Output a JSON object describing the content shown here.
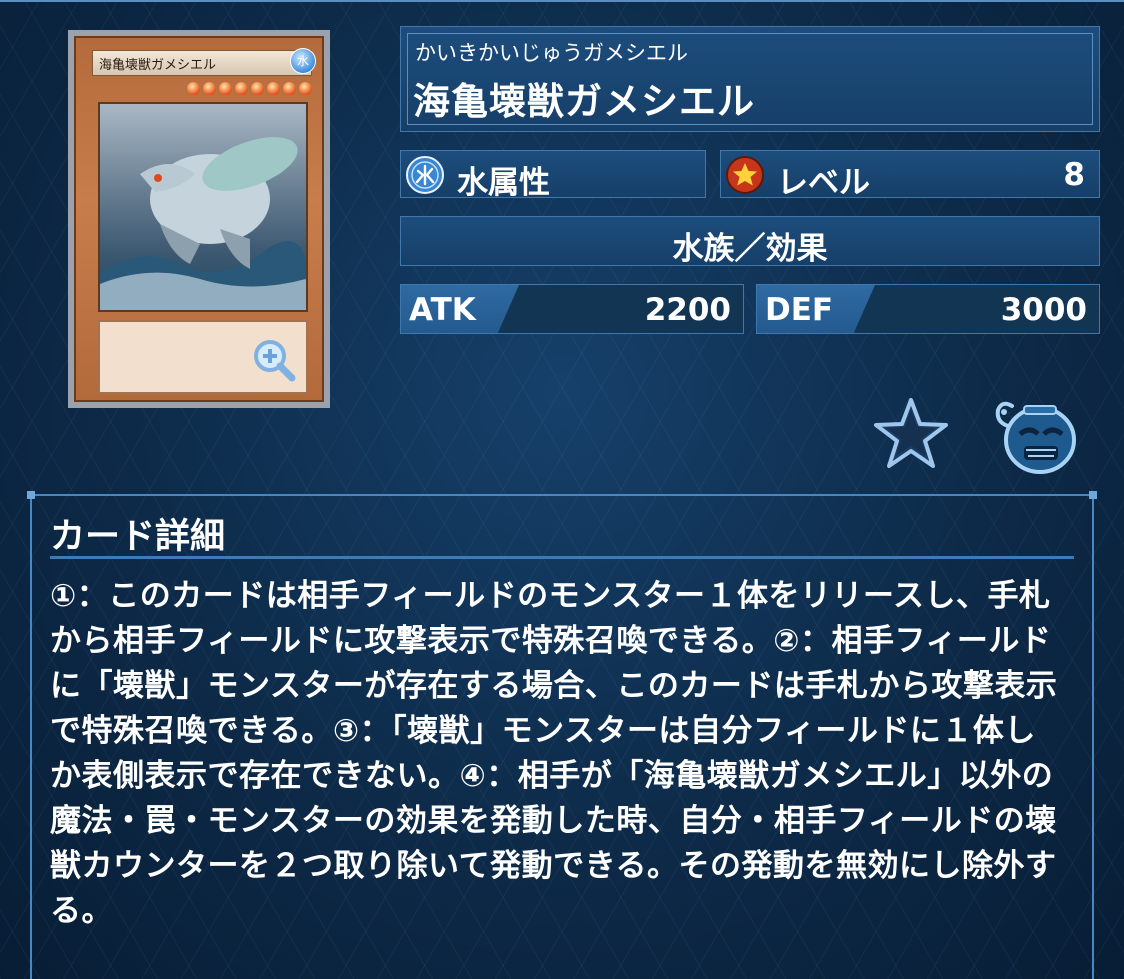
{
  "card": {
    "furigana": "かいきかいじゅうガメシエル",
    "name": "海亀壊獣ガメシエル",
    "attribute_label": "水属性",
    "attribute_icon": "water-attribute-icon",
    "level_label": "レベル",
    "level_value": "8",
    "type_label": "水族／効果",
    "atk_label": "ATK",
    "atk_value": "2200",
    "def_label": "DEF",
    "def_value": "3000",
    "image_name": "海亀壊獣ガメシエル",
    "image_attr_glyph": "水"
  },
  "detail": {
    "heading": "カード詳細",
    "text": "①：このカードは相手フィールドのモンスター１体をリリースし、手札から相手フィールドに攻撃表示で特殊召喚できる。②：相手フィールドに「壊獣」モンスターが存在する場合、このカードは手札から攻撃表示で特殊召喚できる。③：「壊獣」モンスターは自分フィールドに１体しか表側表示で存在できない。④：相手が「海亀壊獣ガメシエル」以外の魔法・罠・モンスターの効果を発動した時、自分・相手フィールドの壊獣カウンターを２つ取り除いて発動できる。その発動を無効にし除外する。"
  },
  "icons": {
    "zoom": "zoom-in-icon",
    "favorite": "star-icon",
    "deck": "deck-pot-icon",
    "level": "level-star-icon"
  },
  "colors": {
    "background": "#0d2a48",
    "panel": "#1d4d7d",
    "accent": "#3f78ad",
    "text": "#ffffff"
  }
}
